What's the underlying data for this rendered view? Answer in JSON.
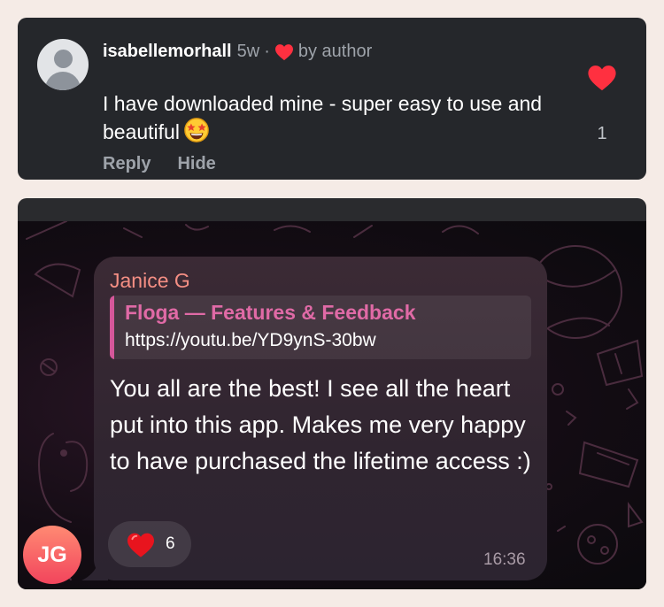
{
  "comment": {
    "username": "isabellemorhall",
    "age": "5w",
    "separator": "·",
    "liked_by_author_label": "by author",
    "text": "I have downloaded mine - super easy to use and beautiful",
    "emoji_icon": "star-struck-emoji",
    "actions": {
      "reply": "Reply",
      "hide": "Hide"
    },
    "like_count": "1",
    "heart_color": "#ff3040"
  },
  "chat": {
    "sender_name": "Janice G",
    "sender_color": "#f58f84",
    "link_preview": {
      "title": "Floga — Features & Feedback",
      "url": "https://youtu.be/YD9ynS-30bw",
      "accent": "#d5579a"
    },
    "message": "You all are the best! I see all the heart put into this app. Makes me very happy to have purchased the lifetime access :)",
    "reaction": {
      "icon": "heart-emoji",
      "count": "6"
    },
    "time": "16:36",
    "avatar_initials": "JG"
  }
}
